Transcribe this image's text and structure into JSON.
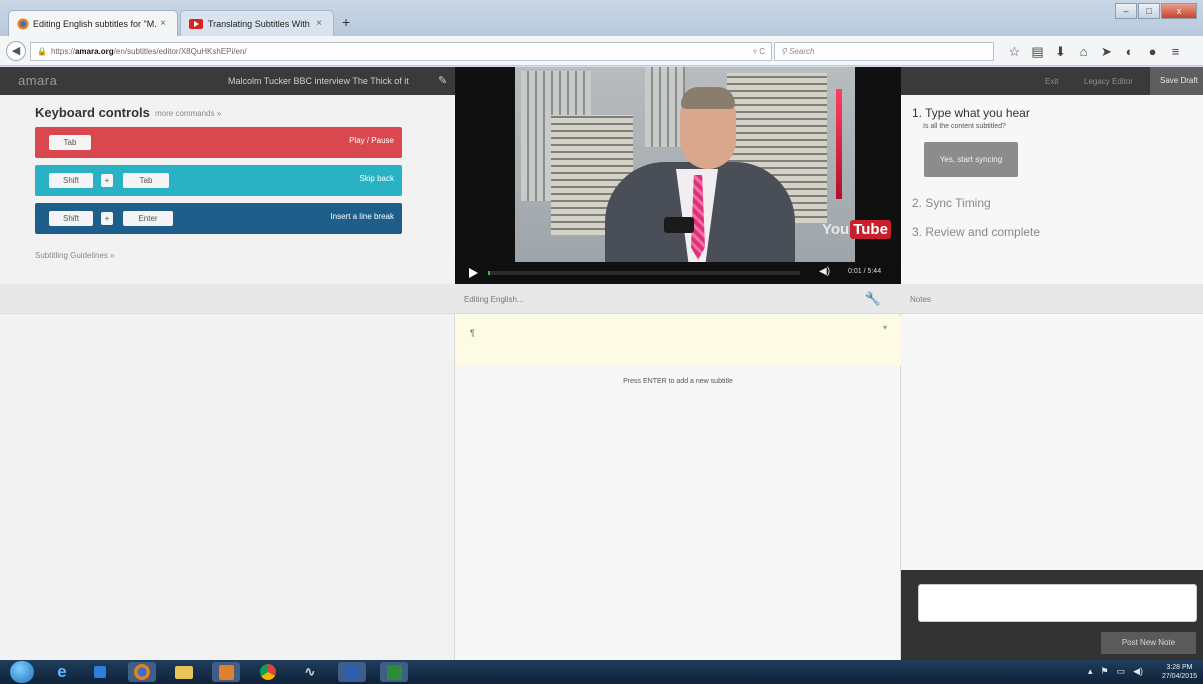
{
  "browser": {
    "tabs": [
      {
        "label": "Editing English subtitles for \"M...",
        "close": "×"
      },
      {
        "label": "Translating Subtitles With ...",
        "close": "×"
      }
    ],
    "new_tab": "+",
    "window_buttons": {
      "minimize": "–",
      "maximize": "□",
      "close": "x"
    },
    "url": {
      "prefix": "https://",
      "host": "amara.org",
      "path": "/en/subtitles/editor/X8QuHKshEPi/en/",
      "reload": "▿ C"
    },
    "search_placeholder": "Search",
    "search_icon": "⚲"
  },
  "header": {
    "logo": "amara",
    "video_title": "Malcolm Tucker BBC interview The Thick of it",
    "exit": "Exit",
    "legacy_editor": "Legacy Editor",
    "save_draft": "Save Draft"
  },
  "keyboard": {
    "title": "Keyboard controls",
    "more": "more commands »",
    "rows": [
      {
        "keys": [
          "Tab"
        ],
        "action": "Play / Pause",
        "color": "#d9474f"
      },
      {
        "keys": [
          "Shift",
          "Tab"
        ],
        "action": "Skip back",
        "color": "#29b2c4"
      },
      {
        "keys": [
          "Shift",
          "Enter"
        ],
        "action": "Insert a line break",
        "color": "#1d5f8a"
      }
    ],
    "plus": "+",
    "guidelines": "Subtitling Guidelines »"
  },
  "video": {
    "time": "0:01 / 5:44",
    "progress_fraction": 0.003,
    "yt_you": "You",
    "yt_tube": "Tube"
  },
  "steps": {
    "step1": "1. Type what you hear",
    "step1_sub": "Is all the content subtitled?",
    "sync_button": "Yes, start syncing",
    "step2": "2. Sync Timing",
    "step3": "3. Review and complete"
  },
  "editor": {
    "label": "Editing English...",
    "pilcrow": "¶",
    "caret": "▾",
    "hint": "Press ENTER to add a new subtitle"
  },
  "notes": {
    "label": "Notes",
    "post": "Post New Note"
  },
  "taskbar": {
    "time": "3:28 PM",
    "date": "27/04/2015",
    "tray_up": "▴"
  }
}
